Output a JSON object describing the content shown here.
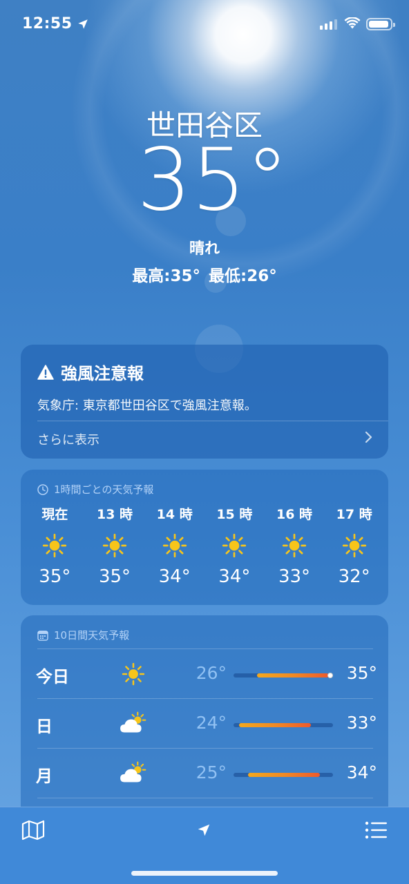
{
  "status_bar": {
    "time": "12:55",
    "battery_level": 0.92,
    "signal_bars": 3
  },
  "location": {
    "city": "世田谷区",
    "temperature": "35°",
    "condition": "晴れ",
    "high": "最高:35°",
    "low": "最低:26°"
  },
  "alert": {
    "title": "強風注意報",
    "body": "気象庁: 東京都世田谷区で強風注意報。",
    "more": "さらに表示"
  },
  "hourly": {
    "heading": "1時間ごとの天気予報",
    "items": [
      {
        "label": "現在",
        "icon": "sun-icon",
        "temp": "35°"
      },
      {
        "label": "13 時",
        "icon": "sun-icon",
        "temp": "35°"
      },
      {
        "label": "14 時",
        "icon": "sun-icon",
        "temp": "34°"
      },
      {
        "label": "15 時",
        "icon": "sun-icon",
        "temp": "34°"
      },
      {
        "label": "16 時",
        "icon": "sun-icon",
        "temp": "33°"
      },
      {
        "label": "17 時",
        "icon": "sun-icon",
        "temp": "32°"
      }
    ]
  },
  "daily": {
    "heading": "10日間天気予報",
    "range_low": 24,
    "range_high": 35,
    "current_temp": 35,
    "items": [
      {
        "day": "今日",
        "icon": "sun-icon",
        "low": "26°",
        "high": "35°",
        "low_value": 26,
        "high_value": 35,
        "show_current": true
      },
      {
        "day": "日",
        "icon": "partly-cloudy-icon",
        "low": "24°",
        "high": "33°",
        "low_value": 24,
        "high_value": 33,
        "show_current": false
      },
      {
        "day": "月",
        "icon": "partly-cloudy-icon",
        "low": "25°",
        "high": "34°",
        "low_value": 25,
        "high_value": 34,
        "show_current": false
      }
    ]
  },
  "colors": {
    "sun_yellow": "#f7c51a",
    "bar_start": "#f4a81d",
    "bar_end": "#ee5a2c"
  }
}
